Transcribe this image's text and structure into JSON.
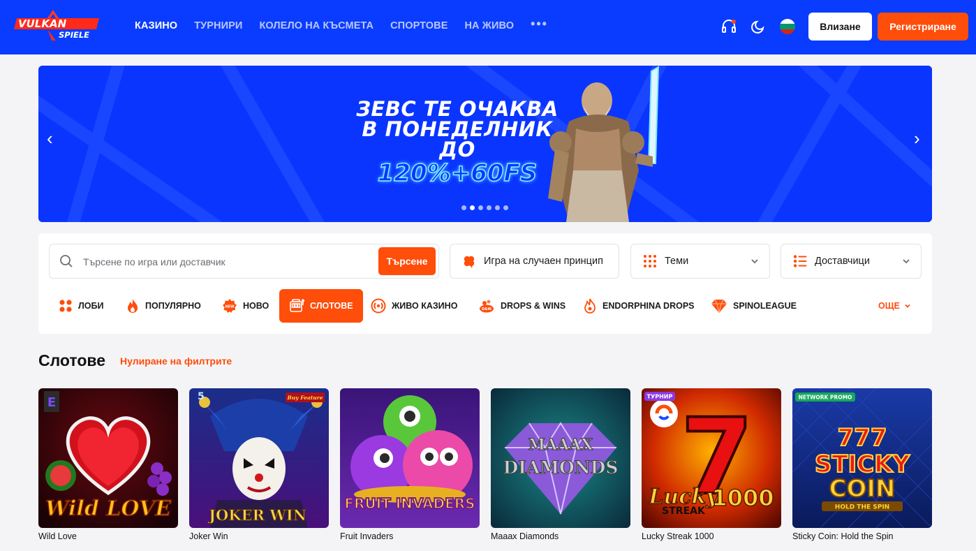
{
  "brand": {
    "logo_word_1": "VULKAN",
    "logo_word_2": "SPIELE"
  },
  "nav": {
    "items": [
      {
        "label": "КАЗИНО",
        "active": true
      },
      {
        "label": "ТУРНИРИ",
        "active": false
      },
      {
        "label": "КОЛЕЛО НА КЪСМЕТА",
        "active": false
      },
      {
        "label": "СПОРТОВЕ",
        "active": false
      },
      {
        "label": "НА ЖИВО",
        "active": false
      }
    ],
    "more_label": "•••"
  },
  "header_icons": [
    "support-headset-icon",
    "dark-mode-moon-icon",
    "language-flag-bg-icon"
  ],
  "auth": {
    "login_label": "Влизане",
    "register_label": "Регистриране"
  },
  "banner": {
    "line1": "ЗЕВС ТЕ ОЧАКВА",
    "line2": "В ПОНЕДЕЛНИК",
    "line3": "ДО",
    "highlight": "120%+60FS",
    "prev_glyph": "‹",
    "next_glyph": "›",
    "slide_count": 6,
    "active_slide": 2
  },
  "search": {
    "placeholder": "Търсене по игра или доставчик",
    "button_label": "Търсене"
  },
  "filters": {
    "random_label": "Игра на случаен принцип",
    "themes_label": "Теми",
    "providers_label": "Доставчици"
  },
  "categories": [
    {
      "label": "ЛОБИ",
      "icon": "lobby-grid-icon",
      "active": false
    },
    {
      "label": "ПОПУЛЯРНО",
      "icon": "flame-icon",
      "active": false
    },
    {
      "label": "НОВО",
      "icon": "new-badge-icon",
      "active": false
    },
    {
      "label": "СЛОТОВЕ",
      "icon": "slot-machine-icon",
      "active": true
    },
    {
      "label": "ЖИВО КАЗИНО",
      "icon": "live-broadcast-icon",
      "active": false
    },
    {
      "label": "DROPS & WINS",
      "icon": "drops-wins-icon",
      "active": false
    },
    {
      "label": "ENDORPHINA DROPS",
      "icon": "endorphina-flame-icon",
      "active": false
    },
    {
      "label": "SPINOLEAGUE",
      "icon": "diamond-icon",
      "active": false
    }
  ],
  "more_categories_label": "ОЩЕ",
  "section": {
    "title": "Слотове",
    "reset_label": "Нулиране на филтрите"
  },
  "games": [
    {
      "name": "Wild Love",
      "art_title": "Wild LOVE",
      "tag": ""
    },
    {
      "name": "Joker Win",
      "art_title": "JOKER WIN",
      "tag": "Buy Feature"
    },
    {
      "name": "Fruit Invaders",
      "art_title": "FRUIT INVADERS",
      "tag": ""
    },
    {
      "name": "Maaax Diamonds",
      "art_title": "MAAAX DIAMONDS",
      "tag": ""
    },
    {
      "name": "Lucky Streak 1000",
      "art_title": "Lucky STREAK 1000",
      "tag": "ТУРНИР"
    },
    {
      "name": "Sticky Coin: Hold the Spin",
      "art_title": "STICKY COIN",
      "tag": "NETWORK PROMO"
    }
  ],
  "colors": {
    "header_blue": "#0a3cff",
    "accent_orange": "#ff4d0a",
    "banner_blue": "#0a35ff"
  }
}
